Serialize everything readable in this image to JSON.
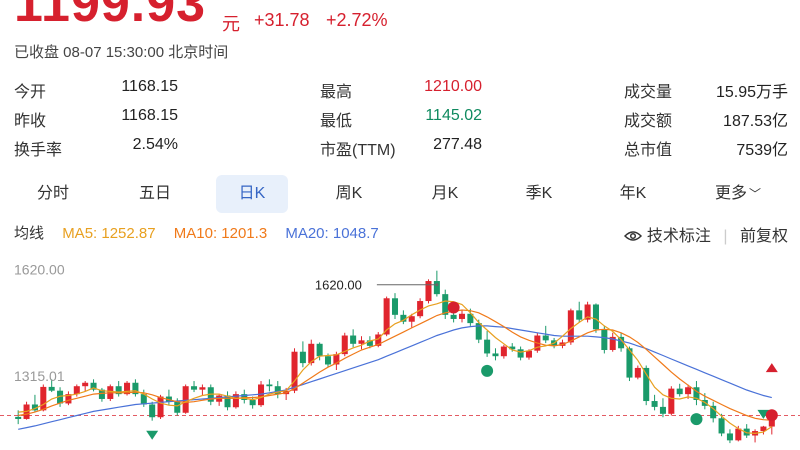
{
  "quote": {
    "price": "1199.93",
    "unit": "元",
    "change": "+31.78",
    "change_pct": "+2.72%",
    "status": "已收盘 08-07 15:30:00 北京时间"
  },
  "stats": [
    {
      "label": "今开",
      "value": "1168.15",
      "color": "#222222"
    },
    {
      "label": "昨收",
      "value": "1168.15",
      "color": "#222222"
    },
    {
      "label": "换手率",
      "value": "2.54%",
      "color": "#222222"
    },
    {
      "label": "最高",
      "value": "1210.00",
      "color": "#d6202e"
    },
    {
      "label": "最低",
      "value": "1145.02",
      "color": "#0f8a5f"
    },
    {
      "label": "市盈(TTM)",
      "value": "277.48",
      "color": "#222222"
    },
    {
      "label": "成交量",
      "value": "15.95万手",
      "color": "#222222"
    },
    {
      "label": "成交额",
      "value": "187.53亿",
      "color": "#222222"
    },
    {
      "label": "总市值",
      "value": "7539亿",
      "color": "#222222"
    }
  ],
  "tabs": [
    {
      "label": "分时",
      "active": false
    },
    {
      "label": "五日",
      "active": false
    },
    {
      "label": "日K",
      "active": true
    },
    {
      "label": "周K",
      "active": false
    },
    {
      "label": "月K",
      "active": false
    },
    {
      "label": "季K",
      "active": false
    },
    {
      "label": "年K",
      "active": false
    },
    {
      "label": "更多",
      "active": false
    }
  ],
  "ma": {
    "label": "均线",
    "ma5": "MA5: 1252.87",
    "ma10": "MA10: 1201.3",
    "ma20": "MA20: 1048.7",
    "ma5_color": "#e8a020",
    "ma10_color": "#f07a1a",
    "ma20_color": "#4a72d8"
  },
  "tools": {
    "tech_label": "技术标注",
    "adjust_label": "前复权",
    "more_icon": "chevron-down-icon",
    "tech_icon": "eye-icon"
  },
  "chart_data": {
    "type": "candlestick",
    "y_ticks": [
      "1620.00",
      "1315.01"
    ],
    "max_label": "1620.00",
    "up_color": "#e0252e",
    "down_color": "#1a9a6a",
    "current_price_line": 1199.93,
    "ylim": [
      1100,
      1680
    ],
    "candles": [
      [
        1196,
        1215,
        1175,
        1190
      ],
      [
        1190,
        1240,
        1188,
        1232
      ],
      [
        1232,
        1260,
        1210,
        1215
      ],
      [
        1215,
        1290,
        1212,
        1283
      ],
      [
        1283,
        1305,
        1268,
        1272
      ],
      [
        1272,
        1282,
        1225,
        1235
      ],
      [
        1235,
        1270,
        1230,
        1262
      ],
      [
        1262,
        1290,
        1255,
        1285
      ],
      [
        1285,
        1300,
        1270,
        1295
      ],
      [
        1295,
        1305,
        1270,
        1275
      ],
      [
        1275,
        1280,
        1240,
        1248
      ],
      [
        1248,
        1290,
        1242,
        1285
      ],
      [
        1285,
        1300,
        1255,
        1262
      ],
      [
        1262,
        1300,
        1258,
        1295
      ],
      [
        1295,
        1305,
        1255,
        1262
      ],
      [
        1262,
        1275,
        1225,
        1232
      ],
      [
        1232,
        1240,
        1185,
        1195
      ],
      [
        1195,
        1260,
        1190,
        1255
      ],
      [
        1255,
        1275,
        1230,
        1240
      ],
      [
        1240,
        1250,
        1200,
        1208
      ],
      [
        1208,
        1290,
        1205,
        1285
      ],
      [
        1285,
        1300,
        1268,
        1275
      ],
      [
        1275,
        1290,
        1258,
        1282
      ],
      [
        1282,
        1290,
        1230,
        1240
      ],
      [
        1240,
        1262,
        1228,
        1258
      ],
      [
        1258,
        1270,
        1215,
        1224
      ],
      [
        1224,
        1270,
        1220,
        1262
      ],
      [
        1262,
        1275,
        1235,
        1245
      ],
      [
        1245,
        1255,
        1220,
        1230
      ],
      [
        1230,
        1300,
        1225,
        1290
      ],
      [
        1290,
        1305,
        1270,
        1285
      ],
      [
        1285,
        1300,
        1250,
        1262
      ],
      [
        1262,
        1280,
        1245,
        1272
      ],
      [
        1272,
        1395,
        1265,
        1385
      ],
      [
        1385,
        1415,
        1340,
        1352
      ],
      [
        1352,
        1420,
        1345,
        1408
      ],
      [
        1408,
        1412,
        1360,
        1372
      ],
      [
        1372,
        1380,
        1340,
        1348
      ],
      [
        1348,
        1385,
        1332,
        1378
      ],
      [
        1378,
        1440,
        1372,
        1432
      ],
      [
        1432,
        1450,
        1398,
        1408
      ],
      [
        1408,
        1430,
        1392,
        1418
      ],
      [
        1418,
        1430,
        1395,
        1402
      ],
      [
        1402,
        1442,
        1398,
        1435
      ],
      [
        1435,
        1545,
        1430,
        1540
      ],
      [
        1540,
        1555,
        1480,
        1492
      ],
      [
        1492,
        1505,
        1465,
        1472
      ],
      [
        1472,
        1495,
        1455,
        1488
      ],
      [
        1488,
        1540,
        1482,
        1532
      ],
      [
        1532,
        1595,
        1525,
        1590
      ],
      [
        1590,
        1620,
        1545,
        1552
      ],
      [
        1552,
        1565,
        1480,
        1492
      ],
      [
        1492,
        1510,
        1470,
        1480
      ],
      [
        1480,
        1505,
        1470,
        1495
      ],
      [
        1495,
        1510,
        1460,
        1468
      ],
      [
        1468,
        1478,
        1410,
        1420
      ],
      [
        1420,
        1445,
        1370,
        1380
      ],
      [
        1380,
        1395,
        1360,
        1372
      ],
      [
        1372,
        1405,
        1365,
        1400
      ],
      [
        1400,
        1410,
        1385,
        1392
      ],
      [
        1392,
        1400,
        1360,
        1368
      ],
      [
        1368,
        1392,
        1362,
        1388
      ],
      [
        1388,
        1440,
        1382,
        1432
      ],
      [
        1432,
        1460,
        1410,
        1418
      ],
      [
        1418,
        1425,
        1395,
        1402
      ],
      [
        1402,
        1420,
        1395,
        1412
      ],
      [
        1412,
        1510,
        1405,
        1505
      ],
      [
        1505,
        1530,
        1470,
        1478
      ],
      [
        1478,
        1530,
        1470,
        1522
      ],
      [
        1522,
        1525,
        1440,
        1450
      ],
      [
        1450,
        1460,
        1380,
        1390
      ],
      [
        1390,
        1440,
        1385,
        1428
      ],
      [
        1428,
        1440,
        1385,
        1395
      ],
      [
        1395,
        1400,
        1300,
        1310
      ],
      [
        1310,
        1345,
        1305,
        1338
      ],
      [
        1338,
        1345,
        1230,
        1242
      ],
      [
        1242,
        1260,
        1215,
        1225
      ],
      [
        1225,
        1250,
        1195,
        1205
      ],
      [
        1205,
        1285,
        1200,
        1278
      ],
      [
        1278,
        1292,
        1255,
        1262
      ],
      [
        1262,
        1290,
        1248,
        1282
      ],
      [
        1282,
        1300,
        1230,
        1245
      ],
      [
        1245,
        1265,
        1218,
        1228
      ],
      [
        1228,
        1240,
        1180,
        1192
      ],
      [
        1192,
        1205,
        1140,
        1148
      ],
      [
        1148,
        1160,
        1120,
        1128
      ],
      [
        1128,
        1170,
        1125,
        1162
      ],
      [
        1162,
        1175,
        1135,
        1142
      ],
      [
        1142,
        1160,
        1122,
        1155
      ],
      [
        1155,
        1170,
        1145,
        1168
      ],
      [
        1168,
        1210,
        1145,
        1199.93
      ]
    ],
    "ma5": [
      1210,
      1212,
      1220,
      1232,
      1248,
      1256,
      1258,
      1262,
      1270,
      1280,
      1272,
      1270,
      1268,
      1270,
      1272,
      1262,
      1248,
      1236,
      1230,
      1228,
      1240,
      1250,
      1258,
      1262,
      1262,
      1256,
      1250,
      1250,
      1246,
      1252,
      1262,
      1268,
      1272,
      1300,
      1332,
      1356,
      1372,
      1374,
      1376,
      1386,
      1396,
      1404,
      1416,
      1422,
      1448,
      1466,
      1476,
      1492,
      1506,
      1518,
      1524,
      1532,
      1530,
      1522,
      1498,
      1470,
      1448,
      1426,
      1408,
      1390,
      1384,
      1388,
      1398,
      1402,
      1410,
      1430,
      1452,
      1470,
      1486,
      1480,
      1460,
      1444,
      1420,
      1390,
      1360,
      1320,
      1282,
      1260,
      1250,
      1248,
      1254,
      1250,
      1238,
      1220,
      1198,
      1178,
      1162,
      1150,
      1148,
      1152,
      1168
    ],
    "ma10": [
      1200,
      1204,
      1210,
      1218,
      1228,
      1236,
      1244,
      1250,
      1256,
      1262,
      1264,
      1266,
      1266,
      1266,
      1268,
      1266,
      1260,
      1252,
      1246,
      1240,
      1238,
      1240,
      1244,
      1248,
      1250,
      1250,
      1250,
      1252,
      1252,
      1254,
      1258,
      1262,
      1266,
      1278,
      1294,
      1310,
      1326,
      1340,
      1352,
      1366,
      1378,
      1390,
      1398,
      1406,
      1418,
      1430,
      1442,
      1454,
      1466,
      1478,
      1490,
      1498,
      1502,
      1506,
      1504,
      1498,
      1486,
      1472,
      1458,
      1442,
      1428,
      1418,
      1410,
      1404,
      1402,
      1406,
      1416,
      1428,
      1440,
      1448,
      1450,
      1448,
      1440,
      1428,
      1412,
      1392,
      1370,
      1348,
      1326,
      1306,
      1288,
      1270,
      1256,
      1244,
      1232,
      1220,
      1210,
      1200,
      1192,
      1188,
      1186
    ],
    "ma20": [
      1160,
      1165,
      1170,
      1176,
      1182,
      1188,
      1194,
      1200,
      1206,
      1212,
      1216,
      1220,
      1224,
      1228,
      1232,
      1234,
      1236,
      1238,
      1240,
      1242,
      1244,
      1246,
      1248,
      1250,
      1252,
      1254,
      1256,
      1258,
      1260,
      1262,
      1266,
      1270,
      1274,
      1282,
      1290,
      1298,
      1306,
      1314,
      1322,
      1330,
      1338,
      1346,
      1354,
      1362,
      1372,
      1382,
      1392,
      1402,
      1412,
      1422,
      1432,
      1440,
      1448,
      1454,
      1458,
      1460,
      1460,
      1458,
      1456,
      1452,
      1448,
      1444,
      1440,
      1436,
      1432,
      1430,
      1430,
      1430,
      1430,
      1428,
      1426,
      1422,
      1416,
      1410,
      1402,
      1394,
      1384,
      1374,
      1364,
      1354,
      1344,
      1334,
      1324,
      1314,
      1304,
      1294,
      1284,
      1274,
      1266,
      1258,
      1252
    ],
    "markers": [
      {
        "i": 16,
        "shape": "tri-down",
        "color": "#1a9a6a",
        "at": "low"
      },
      {
        "i": 52,
        "shape": "dot",
        "color": "#d6202e",
        "at": "mid"
      },
      {
        "i": 56,
        "shape": "dot",
        "color": "#1a9a6a",
        "at": "low"
      },
      {
        "i": 81,
        "shape": "dot",
        "color": "#1a9a6a",
        "at": "low"
      },
      {
        "i": 85,
        "shape": "tri-down",
        "color": "#1a9a6a",
        "at": "low"
      },
      {
        "i": 89,
        "shape": "tri-down",
        "color": "#1a9a6a",
        "at": "high"
      },
      {
        "i": 90,
        "shape": "dot",
        "color": "#d6202e",
        "at": "mid"
      },
      {
        "i": 90,
        "shape": "tri-up",
        "color": "#d6202e",
        "at": "top"
      }
    ]
  }
}
